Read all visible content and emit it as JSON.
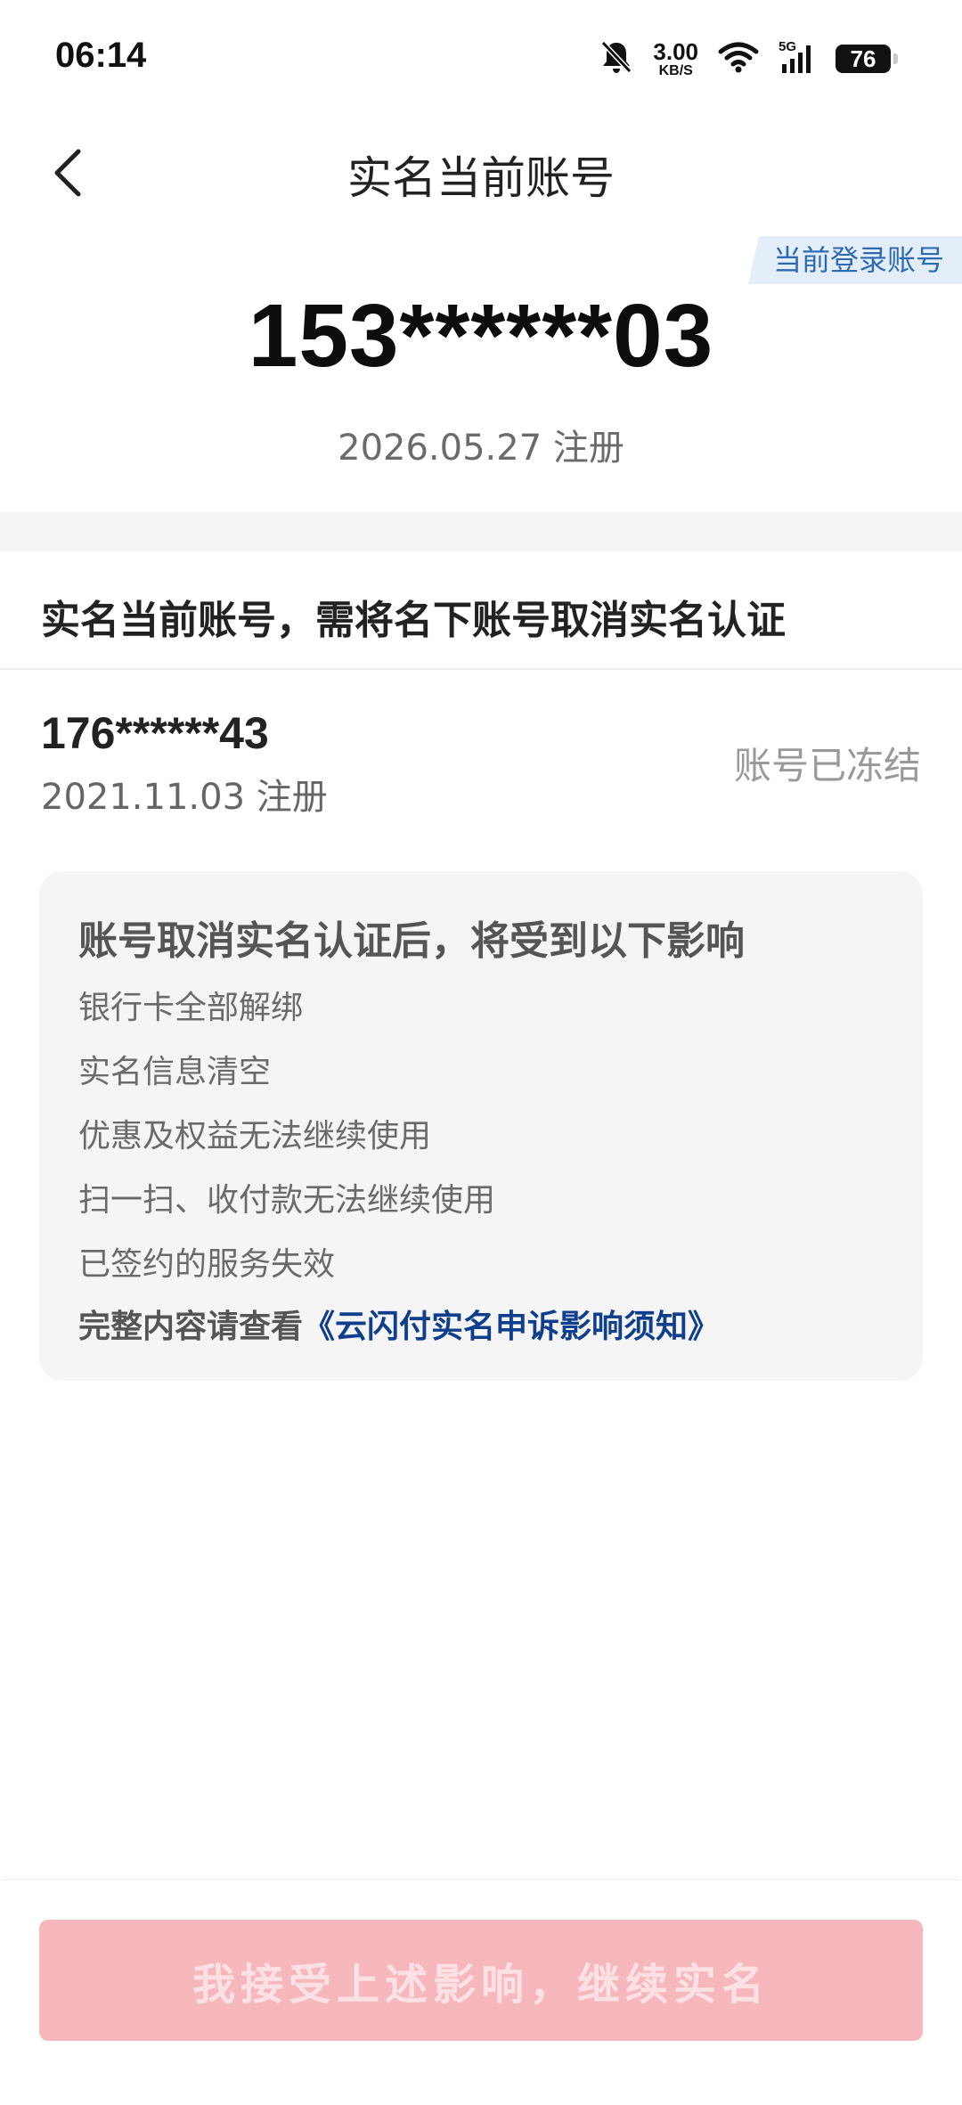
{
  "status_bar": {
    "time": "06:14",
    "net_speed_value": "3.00",
    "net_speed_unit": "KB/S",
    "network": "5G",
    "battery": "76",
    "icons": [
      "bell-off-icon",
      "wifi-icon",
      "signal-icon",
      "battery-icon"
    ]
  },
  "header": {
    "title": "实名当前账号",
    "back_icon": "chevron-left-icon"
  },
  "current_account": {
    "tag": "当前登录账号",
    "number": "153******03",
    "registered": "2026.05.27 注册"
  },
  "section": {
    "heading": "实名当前账号，需将名下账号取消实名认证"
  },
  "other_account": {
    "number": "176******43",
    "registered": "2021.11.03 注册",
    "status": "账号已冻结"
  },
  "impact": {
    "title": "账号取消实名认证后，将受到以下影响",
    "items": [
      "银行卡全部解绑",
      "实名信息清空",
      "优惠及权益无法继续使用",
      "扫一扫、收付款无法继续使用",
      "已签约的服务失效"
    ],
    "link_prefix": "完整内容请查看",
    "link_text": "《云闪付实名申诉影响须知》"
  },
  "footer": {
    "confirm_label": "我接受上述影响，继续实名"
  },
  "colors": {
    "tag_bg": "#e3eef8",
    "tag_text": "#2d6ab3",
    "link": "#0f3f8c",
    "button_disabled_bg": "#f7b8bd"
  }
}
